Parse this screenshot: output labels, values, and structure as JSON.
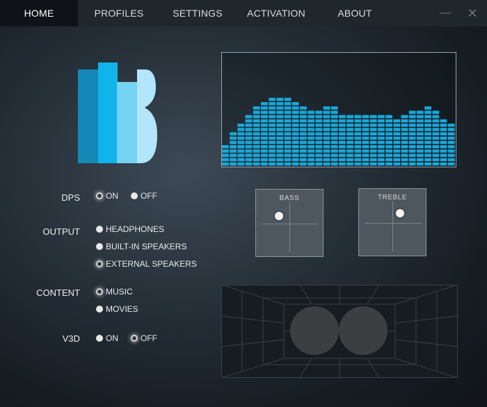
{
  "nav": {
    "tabs": [
      {
        "label": "HOME",
        "active": true
      },
      {
        "label": "PROFILES",
        "active": false
      },
      {
        "label": "SETTINGS",
        "active": false
      },
      {
        "label": "ACTIVATION",
        "active": false
      },
      {
        "label": "ABOUT",
        "active": false
      }
    ],
    "minimize_icon": "minimize-icon",
    "close_icon": "close-icon"
  },
  "settings": {
    "dps": {
      "label": "DPS",
      "options": [
        "ON",
        "OFF"
      ],
      "selected": "ON"
    },
    "output": {
      "label": "OUTPUT",
      "options": [
        "HEADPHONES",
        "BUILT-IN SPEAKERS",
        "EXTERNAL SPEAKERS"
      ],
      "selected": "EXTERNAL SPEAKERS"
    },
    "content": {
      "label": "CONTENT",
      "options": [
        "MUSIC",
        "MOVIES"
      ],
      "selected": "MUSIC"
    },
    "v3d": {
      "label": "V3D",
      "options": [
        "ON",
        "OFF"
      ],
      "selected": "OFF"
    }
  },
  "equalizer": {
    "bar_color": "#17a9dc",
    "levels": [
      5,
      8,
      10,
      12,
      14,
      15,
      16,
      16,
      16,
      15,
      14,
      13,
      13,
      14,
      14,
      12,
      12,
      12,
      12,
      12,
      12,
      12,
      11,
      12,
      13,
      13,
      14,
      13,
      11,
      10
    ]
  },
  "bass": {
    "label": "BASS",
    "level": 0.3
  },
  "treble": {
    "label": "TREBLE",
    "level": 0.62
  },
  "colors": {
    "logo_dark": "#1489b8",
    "logo_mid": "#11b4ea",
    "logo_light": "#74d2f3",
    "logo_pale": "#b3e6fa",
    "accent": "#17a9dc"
  }
}
